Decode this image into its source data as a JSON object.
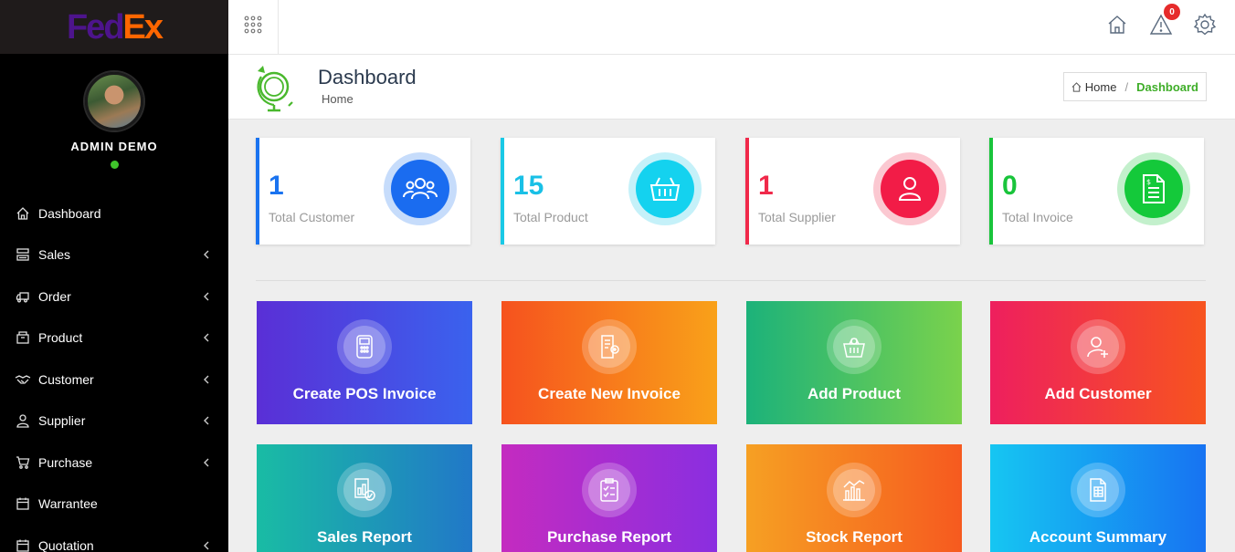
{
  "brand": {
    "logo_fed": "Fed",
    "logo_ex": "Ex"
  },
  "profile": {
    "name": "ADMIN DEMO",
    "status_color": "#3fc52b"
  },
  "sidebar": {
    "items": [
      {
        "label": "Dashboard",
        "icon": "home-icon",
        "has_submenu": false
      },
      {
        "label": "Sales",
        "icon": "sales-icon",
        "has_submenu": true
      },
      {
        "label": "Order",
        "icon": "truck-icon",
        "has_submenu": true
      },
      {
        "label": "Product",
        "icon": "box-icon",
        "has_submenu": true
      },
      {
        "label": "Customer",
        "icon": "handshake-icon",
        "has_submenu": true
      },
      {
        "label": "Supplier",
        "icon": "user-icon",
        "has_submenu": true
      },
      {
        "label": "Purchase",
        "icon": "cart-icon",
        "has_submenu": true
      },
      {
        "label": "Warrantee",
        "icon": "calendar-icon",
        "has_submenu": false
      },
      {
        "label": "Quotation",
        "icon": "calendar-icon",
        "has_submenu": true
      }
    ]
  },
  "topbar": {
    "notification_count": "0"
  },
  "header": {
    "title": "Dashboard",
    "subtitle": "Home"
  },
  "breadcrumb": {
    "home": "Home",
    "current": "Dashboard"
  },
  "stats": [
    {
      "value": "1",
      "label": "Total Customer",
      "color": "#1a73f0"
    },
    {
      "value": "15",
      "label": "Total Product",
      "color": "#19c9e6"
    },
    {
      "value": "1",
      "label": "Total Supplier",
      "color": "#f0294a"
    },
    {
      "value": "0",
      "label": "Total Invoice",
      "color": "#19c43b"
    }
  ],
  "tiles": [
    {
      "label": "Create POS Invoice",
      "icon": "pos-icon"
    },
    {
      "label": "Create New Invoice",
      "icon": "invoice-icon"
    },
    {
      "label": "Add Product",
      "icon": "basket-icon"
    },
    {
      "label": "Add Customer",
      "icon": "add-user-icon"
    },
    {
      "label": "Sales Report",
      "icon": "report-icon"
    },
    {
      "label": "Purchase Report",
      "icon": "clipboard-icon"
    },
    {
      "label": "Stock Report",
      "icon": "chart-icon"
    },
    {
      "label": "Account Summary",
      "icon": "document-icon"
    }
  ]
}
